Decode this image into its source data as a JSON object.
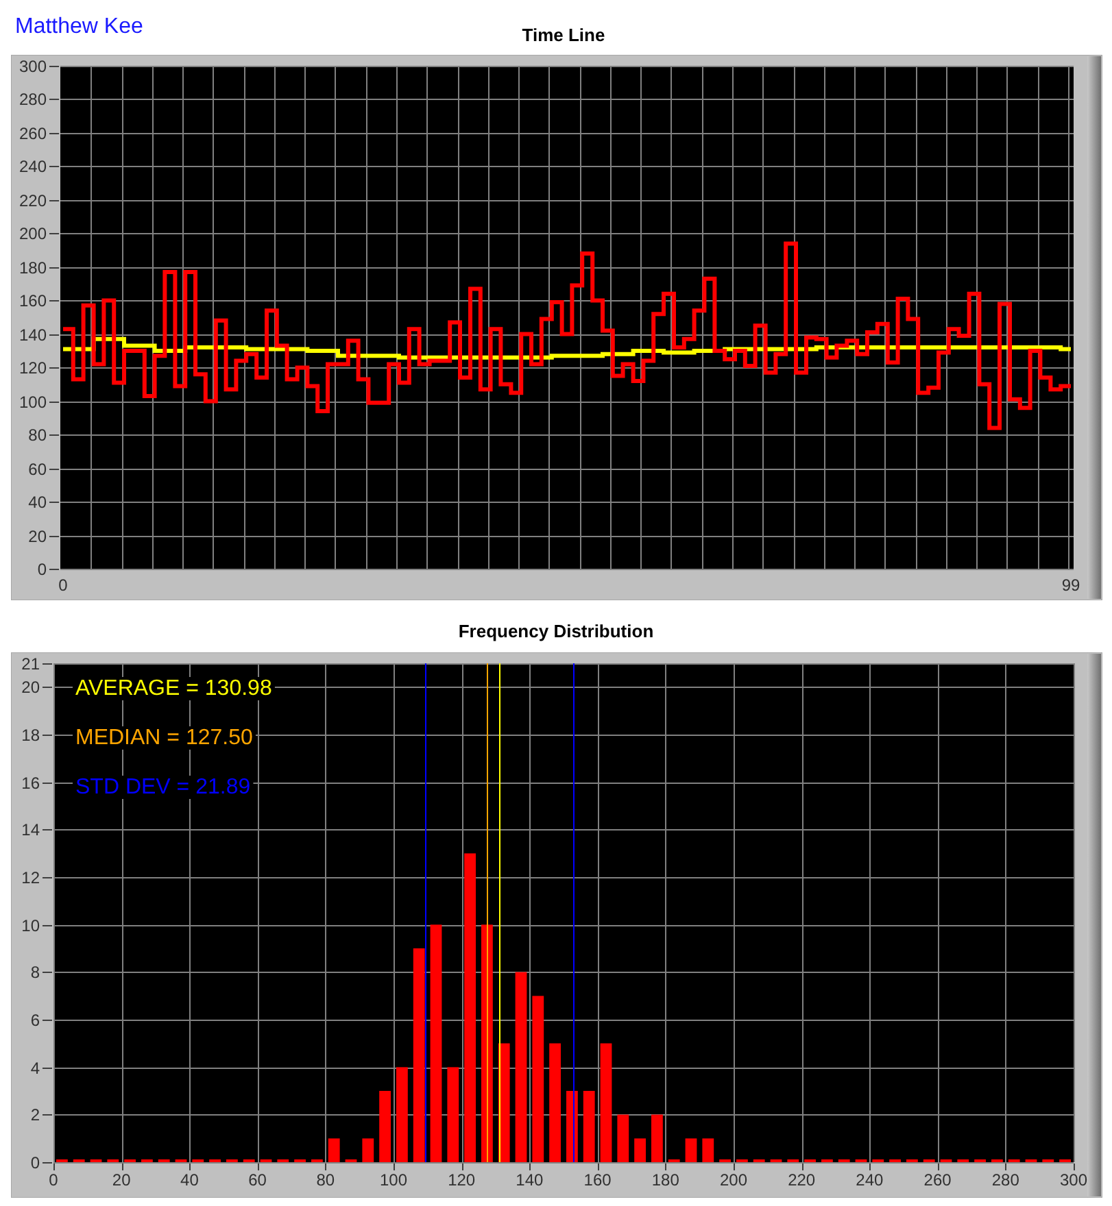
{
  "user_name": "Matthew Kee",
  "timeline": {
    "chart_data": {
      "type": "line",
      "title": "Time Line",
      "grid": true,
      "x": [
        0,
        1,
        1,
        2,
        2,
        3,
        3,
        4,
        4,
        5,
        5,
        6,
        6,
        7,
        7,
        8,
        8,
        9,
        9,
        10,
        10,
        11,
        11,
        12,
        12,
        13,
        13,
        14,
        14,
        15,
        15,
        16,
        16,
        17,
        17,
        18,
        18,
        19,
        19,
        20,
        20,
        21,
        21,
        22,
        22,
        23,
        23,
        24,
        24,
        25,
        25,
        26,
        26,
        27,
        27,
        28,
        28,
        29,
        29,
        30,
        30,
        31,
        31,
        32,
        32,
        33,
        33,
        34,
        34,
        35,
        35,
        36,
        36,
        37,
        37,
        38,
        38,
        39,
        39,
        40,
        40,
        41,
        41,
        42,
        42,
        43,
        43,
        44,
        44,
        45,
        45,
        46,
        46,
        47,
        47,
        48,
        48,
        49,
        49,
        50,
        50,
        51,
        51,
        52,
        52,
        53,
        53,
        54,
        54,
        55,
        55,
        56,
        56,
        57,
        57,
        58,
        58,
        59,
        59,
        60,
        60,
        61,
        61,
        62,
        62,
        63,
        63,
        64,
        64,
        65,
        65,
        66,
        66,
        67,
        67,
        68,
        68,
        69,
        69,
        70,
        70,
        71,
        71,
        72,
        72,
        73,
        73,
        74,
        74,
        75,
        75,
        76,
        76,
        77,
        77,
        78,
        78,
        79,
        79,
        80,
        80,
        81,
        81,
        82,
        82,
        83,
        83,
        84,
        84,
        85,
        85,
        86,
        86,
        87,
        87,
        88,
        88,
        89,
        89,
        90,
        90,
        91,
        91,
        92,
        92,
        93,
        93,
        94,
        94,
        95,
        95,
        96,
        96,
        97,
        97,
        98,
        98,
        99
      ],
      "xlim": [
        0,
        99
      ],
      "ylim": [
        0,
        300
      ],
      "xticks": [
        0,
        99
      ],
      "yticks": [
        0,
        20,
        40,
        60,
        80,
        100,
        120,
        140,
        160,
        180,
        200,
        220,
        240,
        260,
        280,
        300
      ],
      "series": [
        {
          "color": "#ff0000",
          "values": [
            143,
            143,
            113,
            113,
            157,
            157,
            122,
            122,
            160,
            160,
            111,
            111,
            130,
            130,
            130,
            130,
            103,
            103,
            127,
            127,
            177,
            177,
            109,
            109,
            177,
            177,
            116,
            116,
            100,
            100,
            148,
            148,
            107,
            107,
            124,
            124,
            128,
            128,
            114,
            114,
            154,
            154,
            133,
            133,
            113,
            113,
            120,
            120,
            109,
            109,
            94,
            94,
            122,
            122,
            122,
            122,
            136,
            136,
            113,
            113,
            99,
            99,
            99,
            99,
            122,
            122,
            111,
            111,
            143,
            143,
            122,
            122,
            124,
            124,
            124,
            124,
            147,
            147,
            114,
            114,
            167,
            167,
            107,
            107,
            143,
            143,
            110,
            110,
            105,
            105,
            140,
            140,
            122,
            122,
            149,
            149,
            159,
            159,
            140,
            140,
            169,
            169,
            188,
            188,
            160,
            160,
            142,
            142,
            115,
            115,
            122,
            122,
            112,
            112,
            124,
            124,
            152,
            152,
            164,
            164,
            132,
            132,
            137,
            137,
            154,
            154,
            173,
            173,
            130,
            130,
            125,
            125,
            130,
            130,
            121,
            121,
            145,
            145,
            117,
            117,
            128,
            128,
            194,
            194,
            117,
            117,
            138,
            138,
            137,
            137,
            126,
            126,
            133,
            133,
            136,
            136,
            128,
            128,
            141,
            141,
            146,
            146,
            123,
            123,
            161,
            161,
            149,
            149,
            105,
            105,
            108,
            108,
            129,
            129,
            143,
            143,
            139,
            139,
            164,
            164,
            110,
            110,
            84,
            84,
            158,
            158,
            101,
            101,
            96,
            96,
            130,
            130,
            114,
            114,
            107,
            107,
            109,
            109
          ]
        },
        {
          "color": "#ffff00",
          "values": [
            131,
            131,
            131,
            131,
            131,
            131,
            137,
            137,
            137,
            137,
            137,
            137,
            133,
            133,
            133,
            133,
            133,
            133,
            130,
            130,
            130,
            130,
            130,
            130,
            132,
            132,
            132,
            132,
            132,
            132,
            132,
            132,
            132,
            132,
            132,
            132,
            131,
            131,
            131,
            131,
            131,
            131,
            131,
            131,
            131,
            131,
            131,
            131,
            130,
            130,
            130,
            130,
            130,
            130,
            127,
            127,
            127,
            127,
            127,
            127,
            127,
            127,
            127,
            127,
            127,
            127,
            126,
            126,
            126,
            126,
            126,
            126,
            126,
            126,
            126,
            126,
            126,
            126,
            126,
            126,
            126,
            126,
            126,
            126,
            126,
            126,
            126,
            126,
            126,
            126,
            126,
            126,
            126,
            126,
            126,
            126,
            127,
            127,
            127,
            127,
            127,
            127,
            127,
            127,
            127,
            127,
            128,
            128,
            128,
            128,
            128,
            128,
            130,
            130,
            130,
            130,
            130,
            130,
            129,
            129,
            129,
            129,
            129,
            129,
            130,
            130,
            130,
            130,
            130,
            130,
            131,
            131,
            131,
            131,
            131,
            131,
            131,
            131,
            131,
            131,
            131,
            131,
            131,
            131,
            131,
            131,
            131,
            131,
            132,
            132,
            132,
            132,
            132,
            132,
            132,
            132,
            132,
            132,
            132,
            132,
            132,
            132,
            132,
            132,
            132,
            132,
            132,
            132,
            132,
            132,
            132,
            132,
            132,
            132,
            132,
            132,
            132,
            132,
            132,
            132,
            132,
            132,
            132,
            132,
            132,
            132,
            132,
            132,
            132,
            132,
            132,
            132,
            132,
            132,
            132,
            132,
            131,
            131
          ]
        }
      ]
    }
  },
  "distribution": {
    "chart_data": {
      "type": "bar",
      "title": "Frequency Distribution",
      "grid": true,
      "xlim": [
        0,
        300
      ],
      "ylim": [
        0,
        21
      ],
      "xticks": [
        0,
        20,
        40,
        60,
        80,
        100,
        120,
        140,
        160,
        180,
        200,
        220,
        240,
        260,
        280,
        300
      ],
      "yticks": [
        0,
        2,
        4,
        6,
        8,
        10,
        12,
        14,
        16,
        18,
        20,
        21
      ],
      "x": [
        2.5,
        7.5,
        12.5,
        17.5,
        22.5,
        27.5,
        32.5,
        37.5,
        42.5,
        47.5,
        52.5,
        57.5,
        62.5,
        67.5,
        72.5,
        77.5,
        82.5,
        87.5,
        92.5,
        97.5,
        102.5,
        107.5,
        112.5,
        117.5,
        122.5,
        127.5,
        132.5,
        137.5,
        142.5,
        147.5,
        152.5,
        157.5,
        162.5,
        167.5,
        172.5,
        177.5,
        182.5,
        187.5,
        192.5,
        197.5,
        202.5,
        207.5,
        212.5,
        217.5,
        222.5,
        227.5,
        232.5,
        237.5,
        242.5,
        247.5,
        252.5,
        257.5,
        262.5,
        267.5,
        272.5,
        277.5,
        282.5,
        287.5,
        292.5,
        297.5
      ],
      "series": [
        {
          "color": "#ff0000",
          "values": [
            0,
            0,
            0,
            0,
            0,
            0,
            0,
            0,
            0,
            0,
            0,
            0,
            0,
            0,
            0,
            0,
            1,
            0,
            1,
            3,
            4,
            9,
            10,
            4,
            13,
            10,
            5,
            8,
            7,
            5,
            3,
            3,
            5,
            2,
            1,
            2,
            0,
            1,
            1,
            0,
            0,
            0,
            0,
            0,
            0,
            0,
            0,
            0,
            0,
            0,
            0,
            0,
            0,
            0,
            0,
            0,
            0,
            0,
            0,
            0
          ]
        }
      ],
      "ref_lines": [
        {
          "axis": "x",
          "value": 130.98,
          "color": "#ffff00"
        },
        {
          "axis": "x",
          "value": 127.5,
          "color": "#ffa500"
        },
        {
          "axis": "x",
          "value": 109.09,
          "color": "#0000ff"
        },
        {
          "axis": "x",
          "value": 152.87,
          "color": "#0000ff"
        }
      ],
      "annotations": [
        "AVERAGE = 130.98",
        "MEDIAN = 127.50",
        "STD DEV = 21.89"
      ]
    }
  }
}
